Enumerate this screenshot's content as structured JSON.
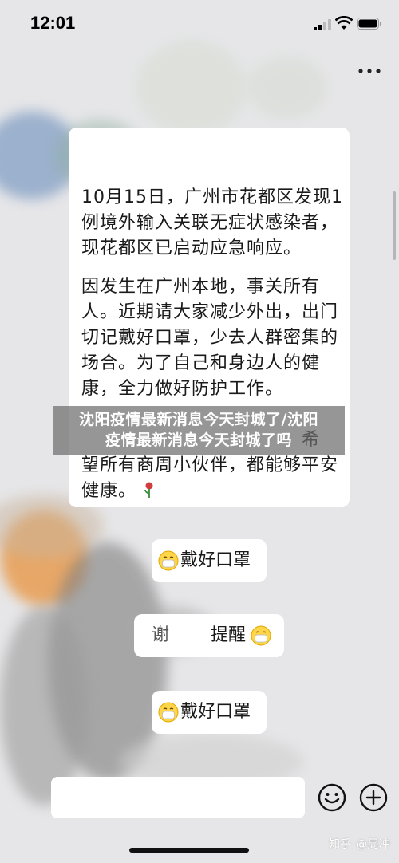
{
  "status_bar": {
    "time": "12:01"
  },
  "header": {
    "more_icon": "more-dots-icon"
  },
  "messages": {
    "main_paragraphs": [
      "10月15日，广州市花都区发现1例境外输入关联无症状感染者，现花都区已启动应急响应。",
      "因发生在广州本地，事关所有人。近期请大家减少外出，出门切记戴好口罩，少去人群密集的场合。为了自己和身边人的健康，全力做好防护工作。",
      "望所有商周小伙伴，都能够平安健康。"
    ],
    "main_tail_fragment": "希",
    "rose_icon": "rose-icon",
    "bubble_1": "戴好口罩",
    "bubble_2_prefix": "谢",
    "bubble_2": "提醒",
    "bubble_3": "戴好口罩",
    "mask_emoji_icon": "mask-emoji-icon"
  },
  "banner": {
    "line1": "沈阳疫情最新消息今天封城了/沈阳",
    "line2": "疫情最新消息今天封城了吗"
  },
  "input_bar": {
    "emoji_icon": "emoji-icon",
    "plus_icon": "plus-icon"
  },
  "watermark": "知乎 @周冲",
  "colors": {
    "background": "#e6e6e8",
    "bubble": "#ffffff",
    "banner": "#6e6e6e",
    "text": "#1a1a1a"
  }
}
